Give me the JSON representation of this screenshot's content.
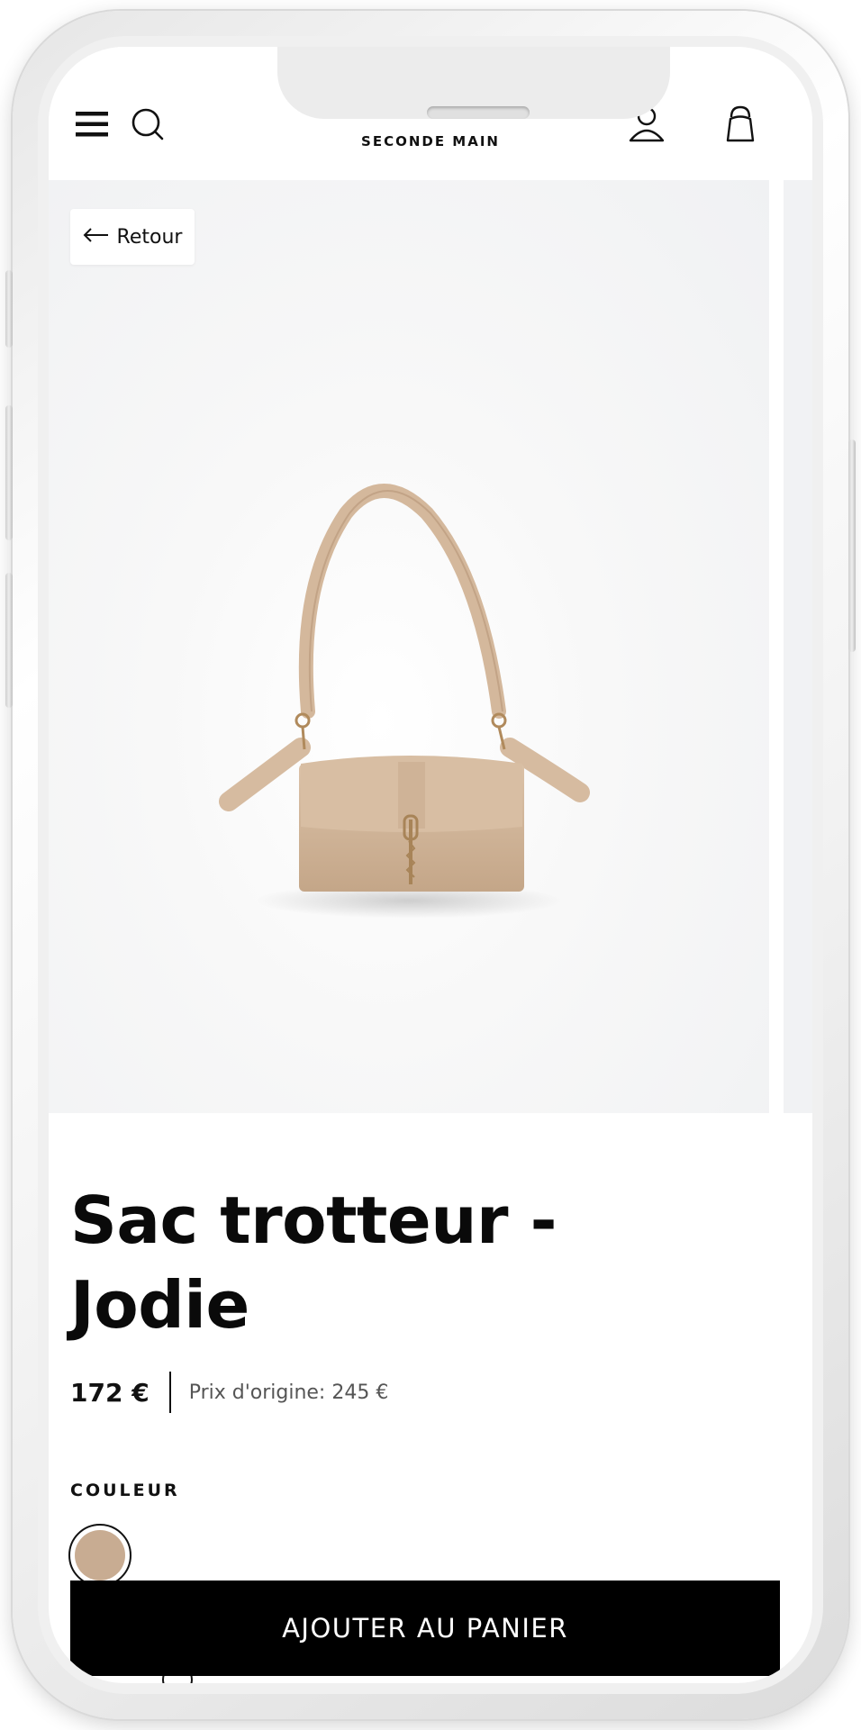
{
  "header": {
    "brand": "SECONDE MAIN",
    "icons": [
      "menu-icon",
      "search-icon",
      "account-icon",
      "bag-icon"
    ]
  },
  "gallery": {
    "back_label": "Retour",
    "back_icon": "arrow-left-icon"
  },
  "product": {
    "title_line1": "Sac trotteur -",
    "title_line2": "Jodie",
    "price": "172 €",
    "original_price": "Prix d'origine: 245 €",
    "color_label": "COULEUR",
    "selected_color": "#c8ac92"
  },
  "cta": {
    "label": "AJOUTER AU PANIER"
  }
}
